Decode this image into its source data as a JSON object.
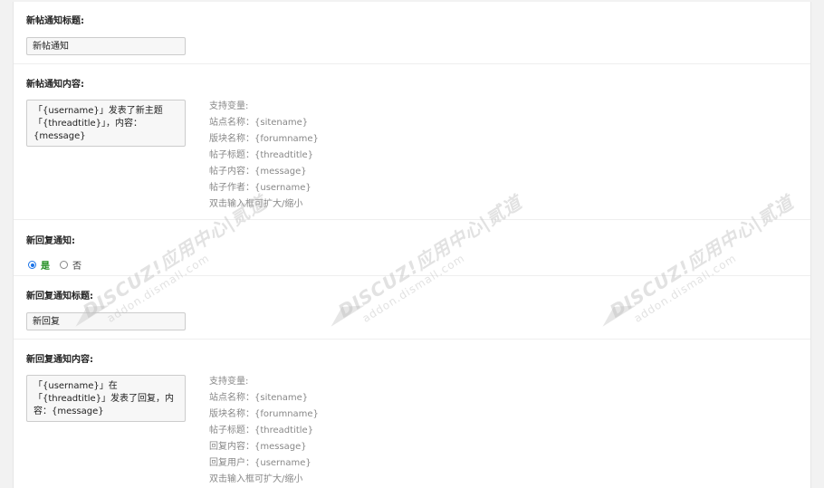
{
  "sections": {
    "new_thread_title": {
      "label": "新帖通知标题:",
      "value": "新帖通知"
    },
    "new_thread_content": {
      "label": "新帖通知内容:",
      "value": "「{username}」发表了新主题「{threadtitle}」，内容：{message}",
      "help": [
        "支持变量:",
        "站点名称：{sitename}",
        "版块名称：{forumname}",
        "帖子标题：{threadtitle}",
        "帖子内容：{message}",
        "帖子作者：{username}",
        "双击输入框可扩大/缩小"
      ]
    },
    "new_reply_notify": {
      "label": "新回复通知:",
      "options": [
        {
          "label": "是",
          "checked": true
        },
        {
          "label": "否",
          "checked": false
        }
      ]
    },
    "new_reply_title": {
      "label": "新回复通知标题:",
      "value": "新回复"
    },
    "new_reply_content": {
      "label": "新回复通知内容:",
      "value": "「{username}」在「{threadtitle}」发表了回复，内容：{message}",
      "help": [
        "支持变量:",
        "站点名称：{sitename}",
        "版块名称：{forumname}",
        "帖子标题：{threadtitle}",
        "回复内容：{message}",
        "回复用户：{username}",
        "双击输入框可扩大/缩小"
      ]
    }
  },
  "watermark": {
    "top": "DISCUZ!应用中心|贰道",
    "bottom": "addon.dismall.com"
  },
  "colors": {
    "radio_accent": "#1a73e8",
    "active_label": "#1a8a1a",
    "help_text": "#888888"
  }
}
